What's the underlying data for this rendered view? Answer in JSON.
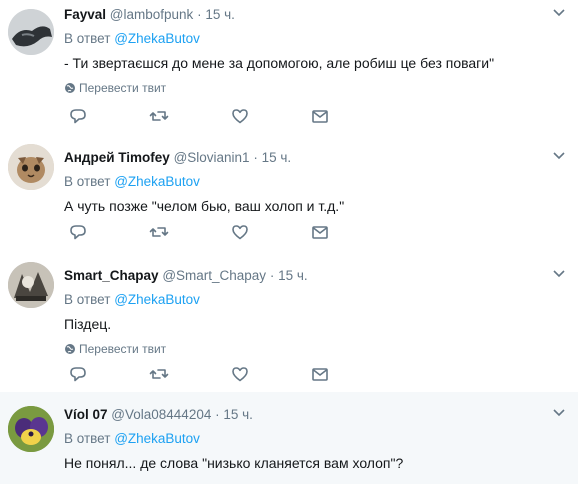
{
  "reply_prefix": "В ответ",
  "icons": {
    "reply": "reply-icon",
    "retweet": "retweet-icon",
    "like": "heart-icon",
    "dm": "envelope-icon",
    "more": "chevron-down-icon",
    "translate": "globe-icon"
  },
  "colors": {
    "link": "#1da1f2",
    "muted": "#657786",
    "text": "#14171a",
    "highlight_bg": "#f5f8fa"
  },
  "tweets": [
    {
      "name": "Fayval",
      "handle": "@lambofpunk",
      "time": "15 ч.",
      "reply_to": "@ZhekaButov",
      "text": "- Ти звертаєшся до мене за допомогою, але робиш це без поваги\"",
      "translate": "Перевести твит"
    },
    {
      "name": "Андрей Timofey",
      "handle": "@Slovianin1",
      "time": "15 ч.",
      "reply_to": "@ZhekaButov",
      "text": "А чуть позже \"челом бью, ваш холоп и т.д.\""
    },
    {
      "name": "Smart_Chapay",
      "handle": "@Smart_Chapay",
      "time": "15 ч.",
      "reply_to": "@ZhekaButov",
      "text": "Пiздец.",
      "translate": "Перевести твит"
    },
    {
      "name": "Víol 07",
      "handle": "@Vola08444204",
      "time": "15 ч.",
      "reply_to": "@ZhekaButov",
      "text": "Не понял... де слова \"низько кланяется вам холоп\"?"
    }
  ]
}
